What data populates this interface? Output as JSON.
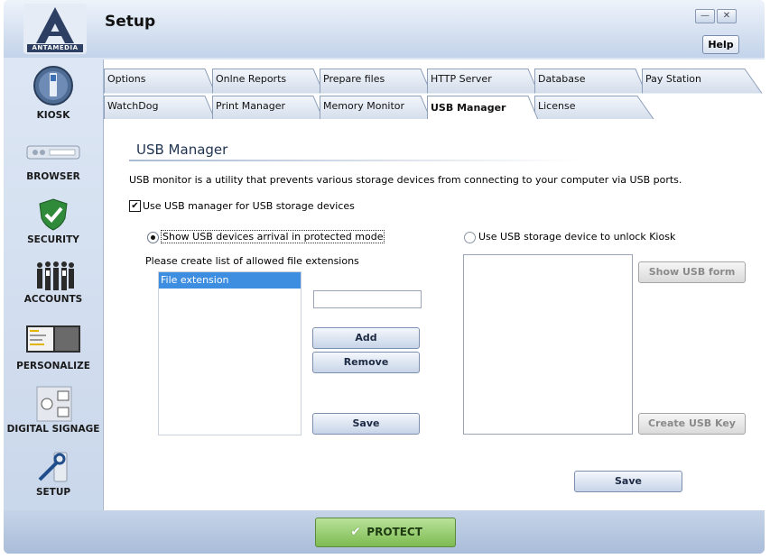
{
  "app": {
    "title": "Setup",
    "logo_text": "ANTAMEDIA",
    "help_label": "Help",
    "minimize_icon": "minimize-icon",
    "close_icon": "close-icon"
  },
  "sidebar": {
    "items": [
      {
        "label": "KIOSK",
        "icon": "kiosk-icon"
      },
      {
        "label": "BROWSER",
        "icon": "browser-icon"
      },
      {
        "label": "SECURITY",
        "icon": "security-shield-icon"
      },
      {
        "label": "ACCOUNTS",
        "icon": "accounts-people-icon"
      },
      {
        "label": "PERSONALIZE",
        "icon": "personalize-icon"
      },
      {
        "label": "DIGITAL SIGNAGE",
        "icon": "digital-signage-icon"
      },
      {
        "label": "SETUP",
        "icon": "setup-tools-icon"
      }
    ]
  },
  "tabs": {
    "row1": [
      "Options",
      "Onlne Reports",
      "Prepare files",
      "HTTP Server",
      "Database",
      "Pay Station"
    ],
    "row2": [
      "WatchDog",
      "Print Manager",
      "Memory Monitor",
      "USB Manager",
      "License"
    ],
    "active": "USB Manager"
  },
  "usb": {
    "heading": "USB Manager",
    "description": "USB monitor is a utility that prevents various storage devices from connecting to your computer via USB ports.",
    "use_checkbox_label": "Use USB manager for USB storage devices",
    "use_checked": true,
    "radio_protected": "Show USB devices arrival in protected mode",
    "radio_unlock": "Use USB storage device to unlock Kiosk",
    "ext_instruction": "Please create list of allowed file extensions",
    "ext_list_header": "File extension",
    "ext_input_value": "",
    "add_label": "Add",
    "remove_label": "Remove",
    "save_left_label": "Save",
    "show_usb_form_label": "Show USB form",
    "create_usb_key_label": "Create USB Key",
    "save_bottom_label": "Save"
  },
  "footer": {
    "protect_label": "PROTECT"
  },
  "colors": {
    "accent": "#3d8ee0",
    "selected_row": "#3d8ee0",
    "protect_green": "#7dbb52"
  }
}
